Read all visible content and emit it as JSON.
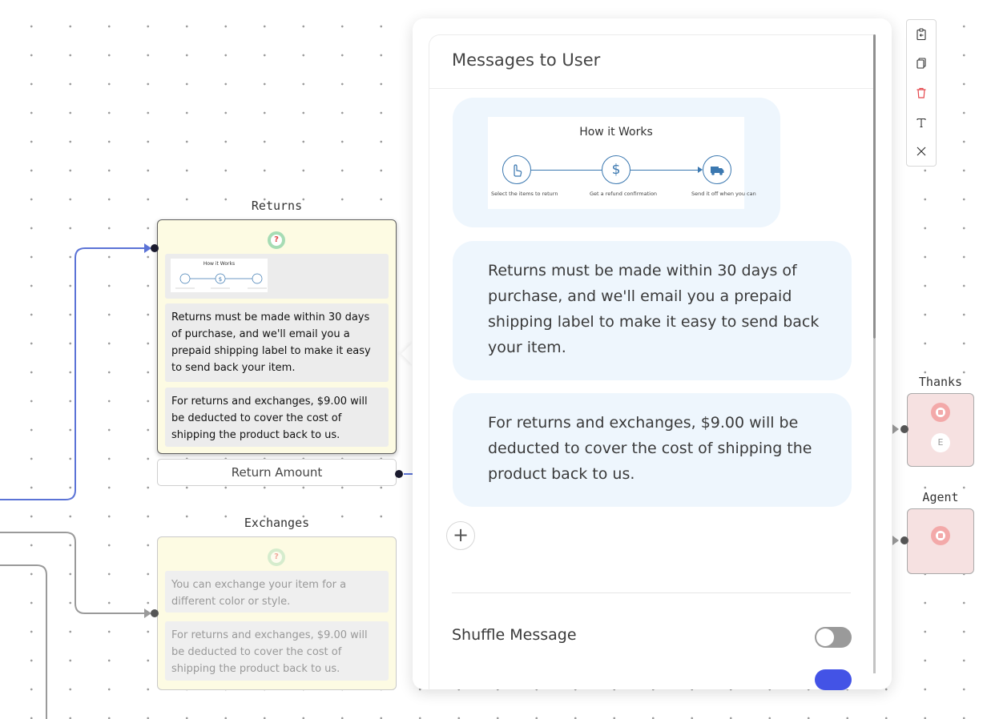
{
  "canvas": {
    "nodes": {
      "returns": {
        "title": "Returns",
        "badge": "?",
        "image_title": "How it Works",
        "messages": [
          "Returns must be made within 30 days of purchase, and we'll email you a prepaid shipping label to make it easy to send back your item.",
          "For returns and exchanges, $9.00 will be deducted to cover the cost of shipping the product back to us."
        ],
        "footer_button": "Return Amount"
      },
      "exchanges": {
        "title": "Exchanges",
        "badge": "?",
        "messages": [
          "You can exchange your item for a different color or style.",
          "For returns and exchanges, $9.00 will be deducted to cover the cost of shipping the product back to us."
        ]
      },
      "thanks": {
        "title": "Thanks",
        "secondary_badge": "E"
      },
      "agent": {
        "title": "Agent"
      }
    }
  },
  "panel": {
    "title": "Messages to User",
    "image_message": {
      "title": "How it Works",
      "steps": [
        {
          "icon": "pointing-hand-icon",
          "caption": "Select the items to return"
        },
        {
          "icon": "dollar-icon",
          "symbol": "$",
          "caption": "Get a refund confirmation"
        },
        {
          "icon": "truck-icon",
          "caption": "Send it off when you can"
        }
      ]
    },
    "messages": [
      "Returns must be made within 30 days of purchase, and we'll email you a prepaid shipping label to make it easy to send back your item.",
      "For returns and exchanges, $9.00 will be deducted to cover the cost of shipping the product back to us."
    ],
    "add_label": "+",
    "shuffle_label": "Shuffle Message",
    "shuffle_enabled": false
  },
  "toolbar": {
    "items": [
      {
        "icon": "paste-icon"
      },
      {
        "icon": "copy-icon"
      },
      {
        "icon": "trash-icon",
        "color": "#e5484d"
      },
      {
        "icon": "text-icon"
      },
      {
        "icon": "close-icon"
      }
    ]
  },
  "colors": {
    "active_connection": "#5b73d6",
    "inactive_connection": "#9a9a9a",
    "node_bg": "#fdfbe3",
    "stop_node_bg": "#f6e1e1",
    "bubble_bg": "#eef6fd",
    "toggle_on": "#4353e6"
  }
}
